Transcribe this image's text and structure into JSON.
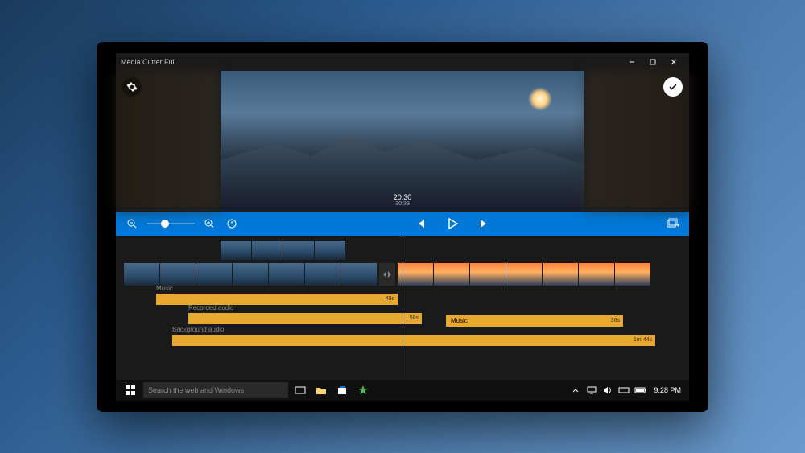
{
  "window": {
    "title": "Media Cutter Full",
    "minimize": "—",
    "maximize": "□",
    "close": "✕"
  },
  "preview": {
    "timecode": "20:30",
    "duration": "30:39"
  },
  "transport": {
    "zoom_out": "zoom-out",
    "zoom_in": "zoom-in",
    "timer": "timer"
  },
  "tracks": {
    "music1": {
      "label": "Music",
      "duration": "49s"
    },
    "recorded": {
      "label": "Recorded audio",
      "duration": "58s"
    },
    "music2": {
      "label": "Music",
      "duration": "36s"
    },
    "background": {
      "label": "Background audio",
      "duration": "1m 44s"
    }
  },
  "taskbar": {
    "search_placeholder": "Search the web and Windows",
    "clock": "9:28 PM"
  }
}
